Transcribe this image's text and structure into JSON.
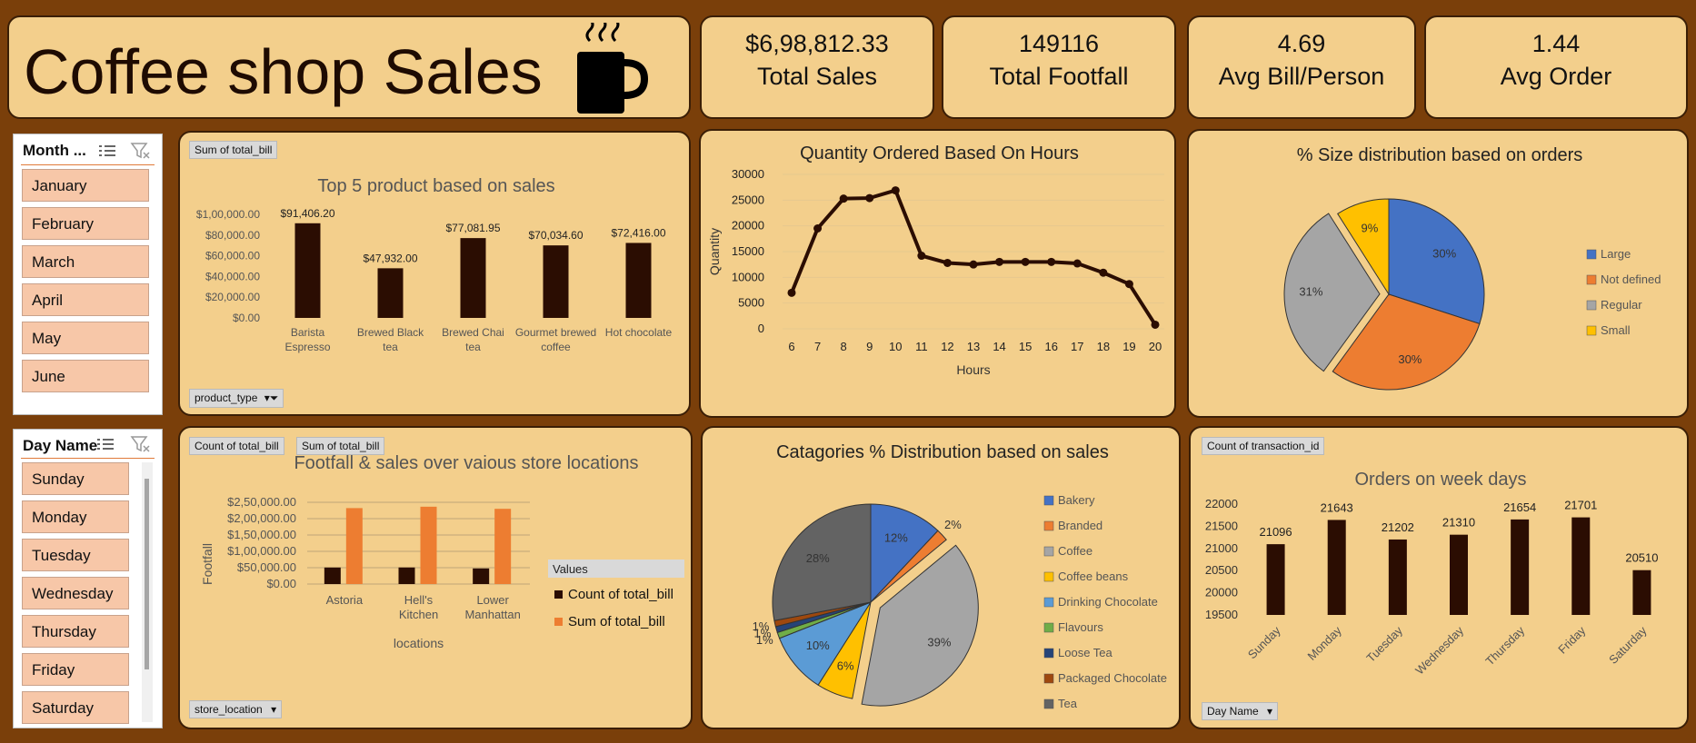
{
  "header": {
    "title": "Coffee shop Sales",
    "icon": "coffee-cup-icon"
  },
  "kpis": [
    {
      "value": "$6,98,812.33",
      "label": "Total Sales"
    },
    {
      "value": "149116",
      "label": "Total Footfall"
    },
    {
      "value": "4.69",
      "label": "Avg Bill/Person"
    },
    {
      "value": "1.44",
      "label": "Avg Order"
    }
  ],
  "month_slicer": {
    "title": "Month ...",
    "items": [
      "January",
      "February",
      "March",
      "April",
      "May",
      "June"
    ]
  },
  "day_slicer": {
    "title": "Day Name",
    "items": [
      "Sunday",
      "Monday",
      "Tuesday",
      "Wednesday",
      "Thursday",
      "Friday",
      "Saturday"
    ]
  },
  "field_tags": {
    "top_products_value": "Sum of total_bill",
    "top_products_axis": "product_type",
    "locations_value1": "Count of total_bill",
    "locations_value2": "Sum of total_bill",
    "locations_axis": "store_location",
    "weekday_value": "Count of transaction_id",
    "weekday_axis": "Day Name"
  },
  "colors": {
    "background": "#7a3f0a",
    "panel": "#f3cf8c",
    "bar_dark": "#2b0d02",
    "orange": "#ed7d31",
    "blue": "#4472c4",
    "gray": "#a5a5a5",
    "gold": "#ffc000"
  },
  "chart_data": [
    {
      "type": "bar",
      "title": "Top 5 product based on sales",
      "categories": [
        "Barista Espresso",
        "Brewed Black tea",
        "Brewed Chai tea",
        "Gourmet brewed coffee",
        "Hot chocolate"
      ],
      "values": [
        91406.2,
        47932.0,
        77081.95,
        70034.6,
        72416.0
      ],
      "data_labels": [
        "$91,406.20",
        "$47,932.00",
        "$77,081.95",
        "$70,034.60",
        "$72,416.00"
      ],
      "yticks": [
        "$1,00,000.00",
        "$80,000.00",
        "$60,000.00",
        "$40,000.00",
        "$20,000.00",
        "$0.00"
      ],
      "ylim": [
        0,
        100000
      ]
    },
    {
      "type": "line",
      "title": "Quantity Ordered Based On Hours",
      "xlabel": "Hours",
      "ylabel": "Quantity",
      "x": [
        6,
        7,
        8,
        9,
        10,
        11,
        12,
        13,
        14,
        15,
        16,
        17,
        18,
        19,
        20
      ],
      "values": [
        7000,
        19500,
        25300,
        25400,
        26900,
        14200,
        12800,
        12500,
        13000,
        13000,
        13000,
        12700,
        10900,
        8700,
        800
      ],
      "yticks": [
        "30000",
        "25000",
        "20000",
        "15000",
        "10000",
        "5000",
        "0"
      ],
      "ylim": [
        0,
        30000
      ]
    },
    {
      "type": "pie",
      "title": "% Size distribution based on orders",
      "labels": [
        "Large",
        "Not defined",
        "Regular",
        "Small"
      ],
      "values": [
        30,
        30,
        31,
        9
      ],
      "data_labels": [
        "30%",
        "30%",
        "31%",
        "9%"
      ],
      "colors": [
        "#4472c4",
        "#ed7d31",
        "#a5a5a5",
        "#ffc000"
      ],
      "legend": "right"
    },
    {
      "type": "bar",
      "title": "Footfall & sales over vaious store locations",
      "xlabel": "locations",
      "ylabel": "Footfall",
      "categories": [
        "Astoria",
        "Hell's Kitchen",
        "Lower Manhattan"
      ],
      "series": [
        {
          "name": "Count of total_bill",
          "values": [
            50599,
            50735,
            47782
          ]
        },
        {
          "name": "Sum of total_bill",
          "values": [
            232243.91,
            236511.17,
            230057.25
          ]
        }
      ],
      "legend_title": "Values",
      "yticks": [
        "$2,50,000.00",
        "$2,00,000.00",
        "$1,50,000.00",
        "$1,00,000.00",
        "$50,000.00",
        "$0.00"
      ],
      "ylim": [
        0,
        250000
      ],
      "legend": "right"
    },
    {
      "type": "pie",
      "title": "Catagories % Distribution based on sales",
      "labels": [
        "Bakery",
        "Branded",
        "Coffee",
        "Coffee beans",
        "Drinking Chocolate",
        "Flavours",
        "Loose Tea",
        "Packaged Chocolate",
        "Tea"
      ],
      "values": [
        12,
        2,
        39,
        6,
        10,
        1,
        1,
        1,
        28
      ],
      "data_labels": [
        "12%",
        "2%",
        "39%",
        "6%",
        "10%",
        "1%",
        "1%",
        "1%",
        "28%"
      ],
      "colors": [
        "#4472c4",
        "#ed7d31",
        "#a5a5a5",
        "#ffc000",
        "#5b9bd5",
        "#70ad47",
        "#264478",
        "#9e480e",
        "#636363"
      ],
      "legend": "right"
    },
    {
      "type": "bar",
      "title": "Orders on week days",
      "categories": [
        "Sunday",
        "Monday",
        "Tuesday",
        "Wednesday",
        "Thursday",
        "Friday",
        "Saturday"
      ],
      "values": [
        21096,
        21643,
        21202,
        21310,
        21654,
        21701,
        20510
      ],
      "yticks": [
        "22000",
        "21500",
        "21000",
        "20500",
        "20000",
        "19500"
      ],
      "ylim": [
        19500,
        22000
      ]
    }
  ]
}
